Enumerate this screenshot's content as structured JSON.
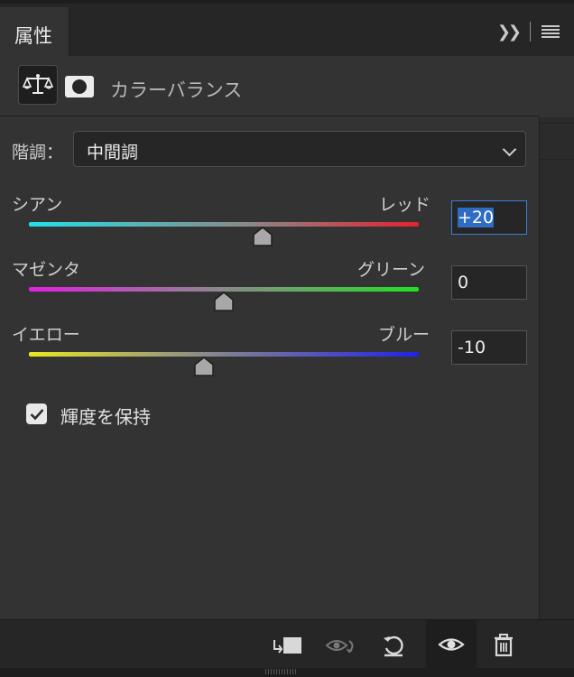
{
  "panel": {
    "tab_label": "属性"
  },
  "adjustment": {
    "title": "カラーバランス",
    "icon": "balance-scale-icon",
    "mask_icon": "layer-mask-icon"
  },
  "tone": {
    "label": "階調：",
    "selected": "中間調"
  },
  "sliders": [
    {
      "left": "シアン",
      "right": "レッド",
      "value": "+20",
      "level": 20
    },
    {
      "left": "マゼンタ",
      "right": "グリーン",
      "value": "0",
      "level": 0
    },
    {
      "left": "イエロー",
      "right": "ブルー",
      "value": "-10",
      "level": -10
    }
  ],
  "preserve_luminosity": {
    "label": "輝度を保持",
    "checked": true
  },
  "toolbar": {
    "clip_icon": "clip-to-layer-icon",
    "view_previous_icon": "view-previous-state-icon",
    "reset_icon": "reset-icon",
    "visibility_icon": "visibility-eye-icon",
    "delete_icon": "trash-icon"
  }
}
